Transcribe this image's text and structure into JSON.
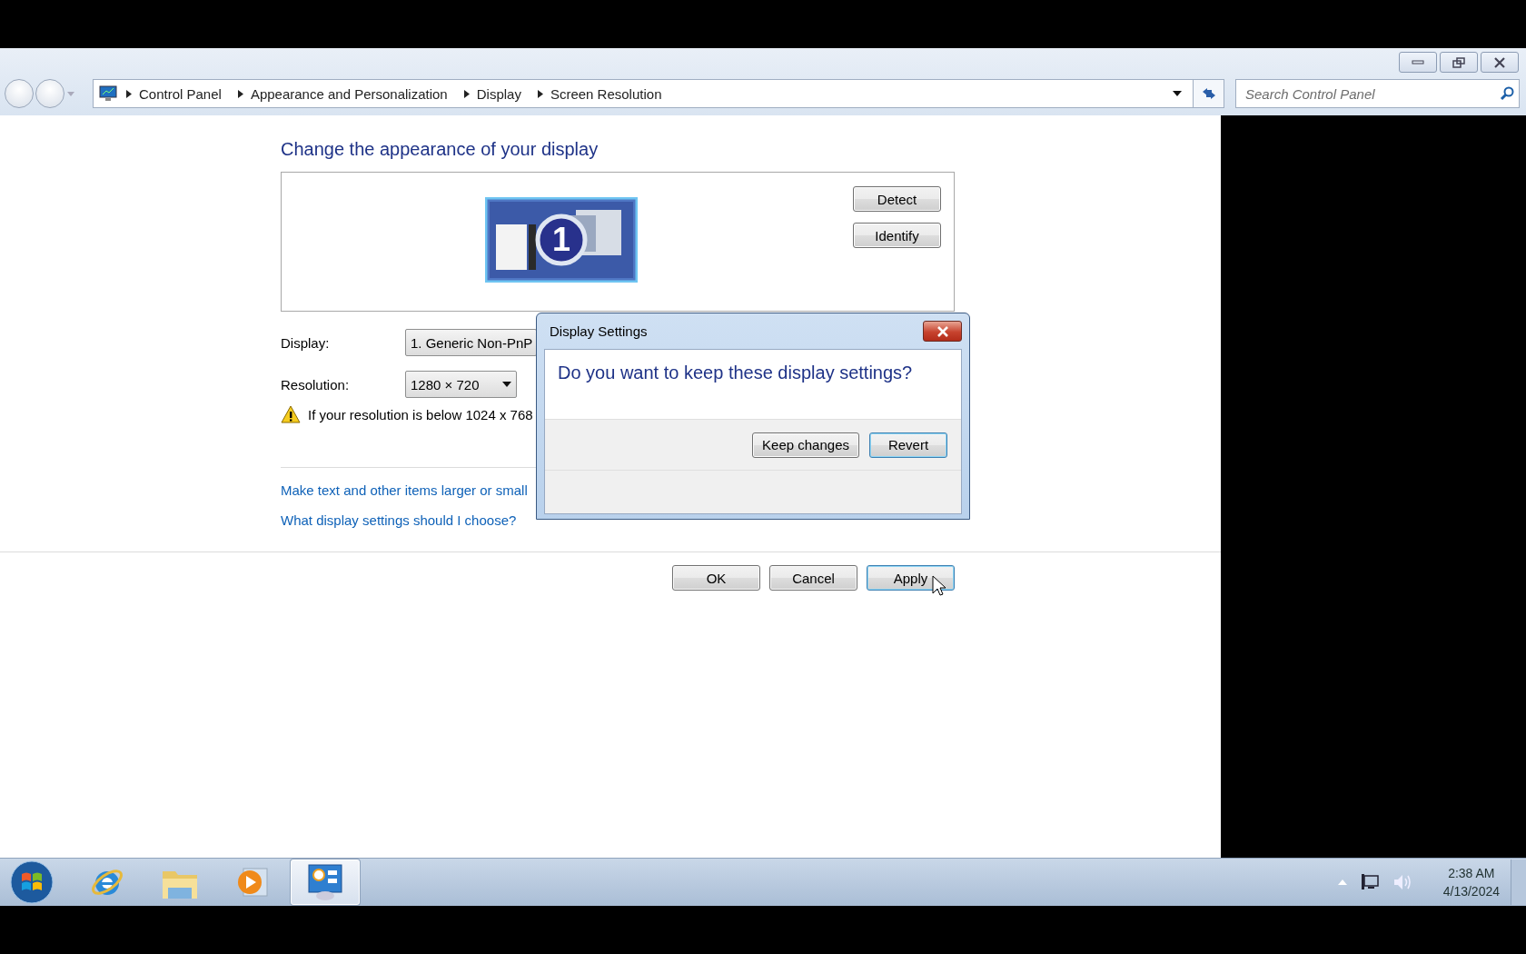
{
  "breadcrumb": [
    "Control Panel",
    "Appearance and Personalization",
    "Display",
    "Screen Resolution"
  ],
  "search": {
    "placeholder": "Search Control Panel"
  },
  "heading": "Change the appearance of your display",
  "monitor": {
    "number": "1"
  },
  "panel_buttons": [
    {
      "label": "Detect"
    },
    {
      "label": "Identify"
    }
  ],
  "fields": [
    {
      "label": "Display:",
      "value": "1. Generic Non-PnP",
      "kind": "plain"
    },
    {
      "label": "Resolution:",
      "value": "1280 × 720",
      "kind": "dropdown"
    }
  ],
  "warning": "If your resolution is below 1024 x 768",
  "links": [
    "Make text and other items larger or small",
    "What display settings should I choose?"
  ],
  "footer_buttons": [
    {
      "label": "OK",
      "focused": false
    },
    {
      "label": "Cancel",
      "focused": false
    },
    {
      "label": "Apply",
      "focused": true
    }
  ],
  "dialog": {
    "title": "Display Settings",
    "question": "Do you want to keep these display settings?",
    "buttons": [
      {
        "label": "Keep changes",
        "focused": false
      },
      {
        "label": "Revert",
        "focused": true
      }
    ]
  },
  "taskbar": {
    "apps": [
      {
        "kind": "ie",
        "selected": false
      },
      {
        "kind": "folder",
        "selected": false
      },
      {
        "kind": "media",
        "selected": false
      },
      {
        "kind": "control-panel",
        "selected": true
      }
    ],
    "time": "2:38 AM",
    "date": "4/13/2024"
  }
}
